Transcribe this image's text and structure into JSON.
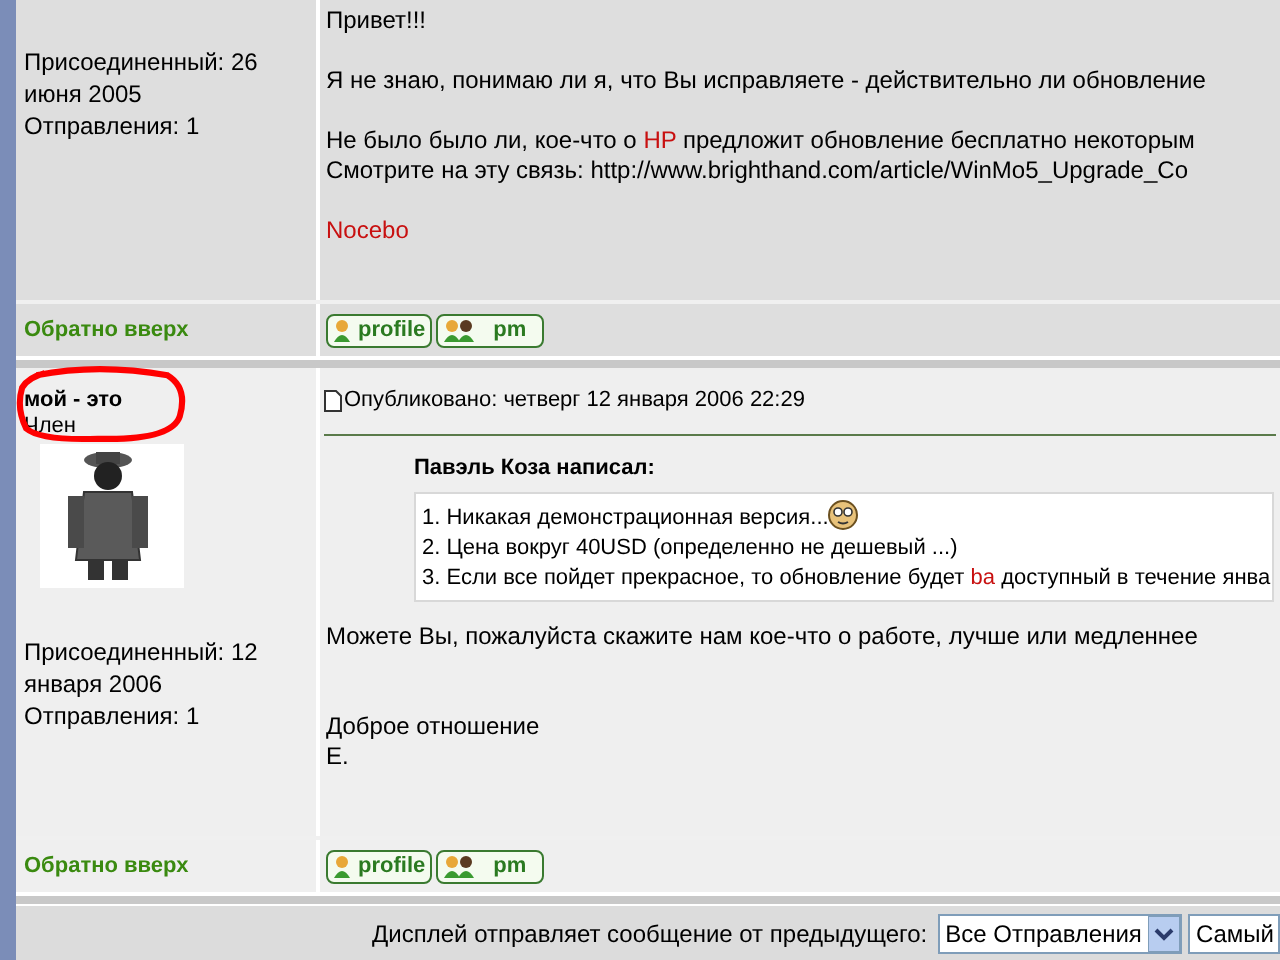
{
  "posts": [
    {
      "joined": "Присоединенный: 26 июня 2005",
      "post_count": "Отправления: 1",
      "body": [
        [
          [
            {
              "text": "Привет!!!",
              "red": false
            }
          ]
        ],
        [
          [
            {
              "text": "Я не знаю, понимаю ли я, что Вы исправляете - действительно ли обновление",
              "red": false
            }
          ]
        ],
        [
          [
            {
              "text": "Не было было ли, кое-что о ",
              "red": false
            },
            {
              "text": "HP",
              "red": true
            },
            {
              "text": " предложит обновление бесплатно некоторым",
              "red": false
            }
          ],
          [
            {
              "text": "Смотрите на эту связь: http://www.brighthand.com/article/WinMo5_Upgrade_Co",
              "red": false
            }
          ]
        ],
        [
          [
            {
              "text": "Nocebo",
              "red": true
            }
          ]
        ]
      ],
      "back_to_top": "Обратно вверх",
      "buttons": [
        "profile",
        "pm"
      ]
    },
    {
      "author": "мой - это",
      "rank": "Член",
      "avatar": true,
      "annotated": true,
      "joined": "Присоединенный: 12 января 2006",
      "post_count": "Отправления: 1",
      "posted": "Опубликовано: четверг 12 января 2006 22:29",
      "quote": {
        "author": "Павэль Коза написал:",
        "lines": [
          [
            {
              "text": "1. Никакая демонстрационная версия...",
              "red": false,
              "smiley": true
            }
          ],
          [
            {
              "text": "2. Цена вокруг 40USD (определенно не дешевый ...)",
              "red": false
            }
          ],
          [
            {
              "text": "3. Если все пойдет прекрасное, то обновление будет ",
              "red": false
            },
            {
              "text": "ba",
              "red": true
            },
            {
              "text": " доступный в течение янва",
              "red": false
            }
          ]
        ]
      },
      "body": [
        [
          [
            {
              "text": "Можете Вы, пожалуйста скажите нам кое-что о работе, лучше или медленнее",
              "red": false
            }
          ]
        ],
        [
          [
            {
              "text": "Доброе отношение",
              "red": false
            }
          ],
          [
            {
              "text": "Е.",
              "red": false
            }
          ]
        ]
      ],
      "back_to_top": "Обратно вверх",
      "buttons": [
        "profile",
        "pm"
      ]
    }
  ],
  "footer": {
    "label": "Дисплей отправляет сообщение от предыдущего:",
    "select": "Все Отправления",
    "select_2": "Самый"
  }
}
